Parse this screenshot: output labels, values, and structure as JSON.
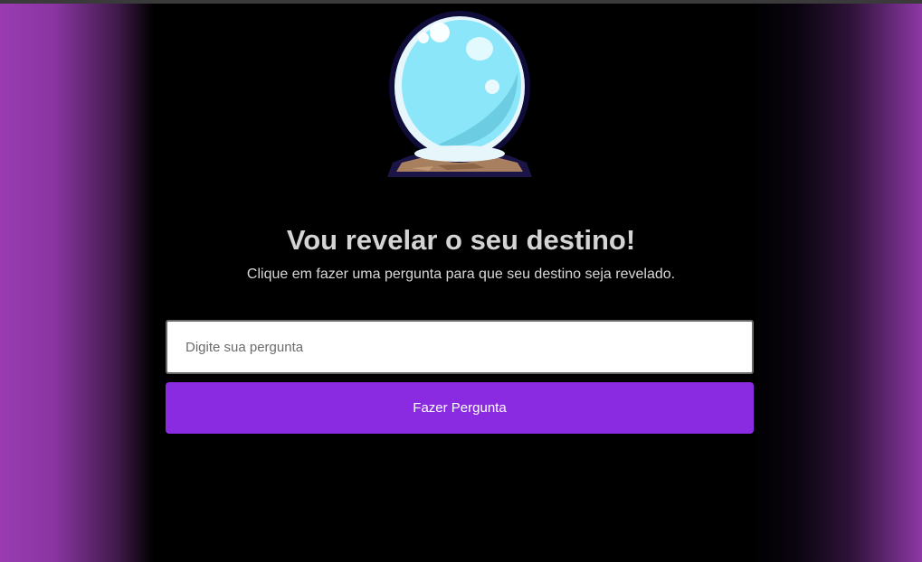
{
  "header": {
    "title": "Vou revelar o seu destino!",
    "subtitle": "Clique em fazer uma pergunta para que seu destino seja revelado."
  },
  "form": {
    "question_placeholder": "Digite sua pergunta",
    "question_value": "",
    "ask_button_label": "Fazer Pergunta"
  },
  "illustration": {
    "icon": "crystal-ball-icon"
  },
  "colors": {
    "accent": "#8a2be2",
    "background": "#000000",
    "side_glow": "#9a3bb3",
    "title_text": "#d4d4d4"
  }
}
